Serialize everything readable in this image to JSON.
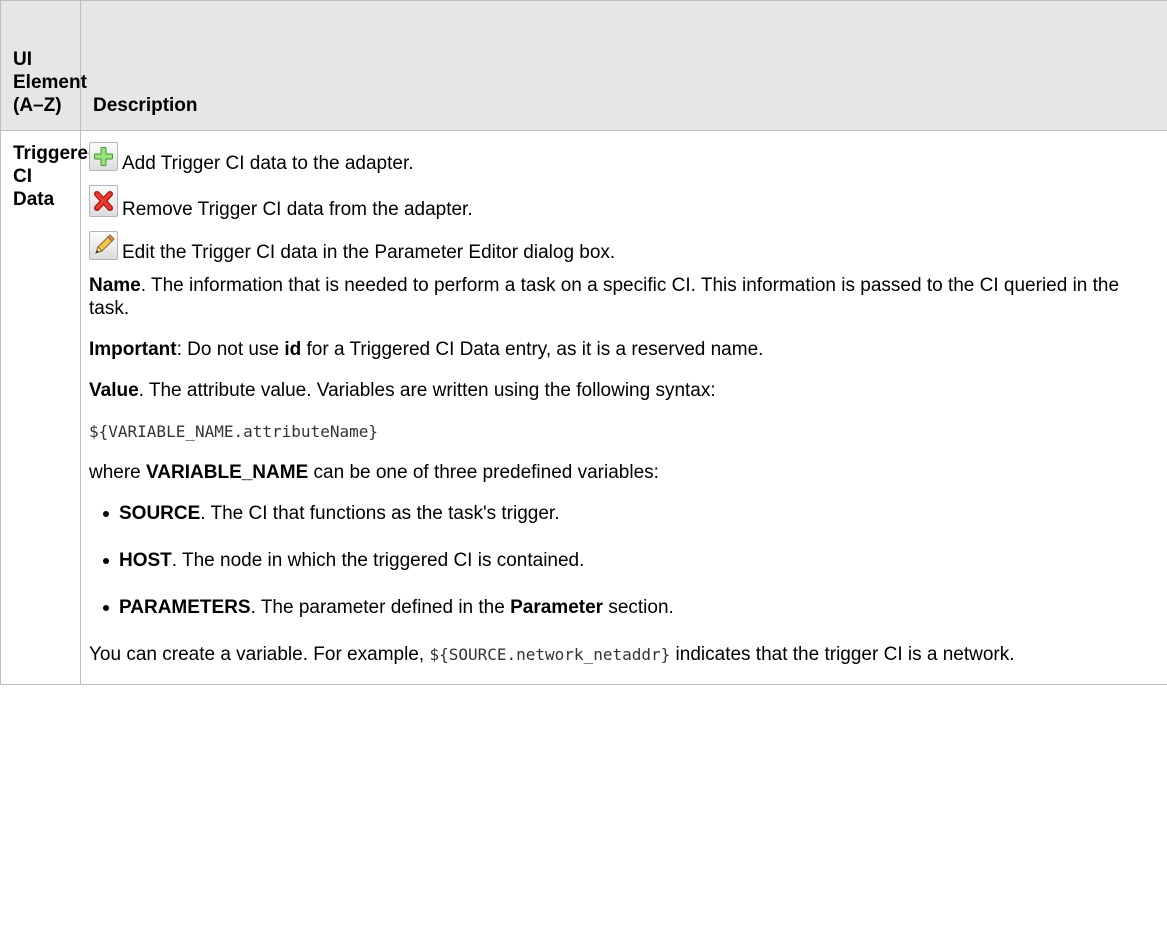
{
  "header": {
    "col1": "UI Element (A–Z)",
    "col2": "Description"
  },
  "row": {
    "element": "Triggered CI Data",
    "icon_actions": [
      {
        "icon": "add-icon",
        "text": "Add Trigger CI data to the adapter."
      },
      {
        "icon": "remove-icon",
        "text": "Remove Trigger CI data from the adapter."
      },
      {
        "icon": "edit-icon",
        "text": "Edit the Trigger CI data in the Parameter Editor dialog box."
      }
    ],
    "name_label": "Name",
    "name_text": ". The information that is needed to perform a task on a specific CI. This information is passed to the CI queried in the task.",
    "important_label": "Important",
    "important_pre": ": Do not use ",
    "important_id": "id",
    "important_post": " for a Triggered CI Data entry, as it is a reserved name.",
    "value_label": "Value",
    "value_text": ". The attribute value. Variables are written using the following syntax:",
    "syntax": "${VARIABLE_NAME.attributeName}",
    "where_pre": "where ",
    "where_var": "VARIABLE_NAME",
    "where_post": " can be one of three predefined variables:",
    "variables": [
      {
        "name": "SOURCE",
        "desc": ". The CI that functions as the task's trigger."
      },
      {
        "name": "HOST",
        "desc": ". The node in which the triggered CI is contained."
      },
      {
        "name": "PARAMETERS",
        "desc": ". The parameter defined in the ",
        "bold": "Parameter",
        "after": " section."
      }
    ],
    "create_pre": "You can create a variable. For example, ",
    "create_code": "${SOURCE.network_netaddr}",
    "create_post": "  indicates that the trigger CI is a network."
  },
  "colors": {
    "header_bg": "#e6e6e6",
    "border": "#bdbdbd",
    "add_green": "#3a9b2c",
    "remove_red": "#d9261c"
  }
}
